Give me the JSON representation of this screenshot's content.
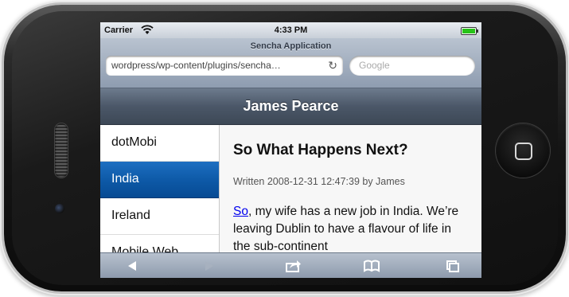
{
  "status_bar": {
    "carrier": "Carrier",
    "time": "4:33 PM",
    "icons": [
      "wifi-icon",
      "battery-icon"
    ]
  },
  "browser": {
    "page_title": "Sencha Application",
    "url": "wordpress/wp-content/plugins/sencha…",
    "search_placeholder": "Google",
    "reload_icon": "reload-icon"
  },
  "app": {
    "title": "James Pearce"
  },
  "sidebar": {
    "items": [
      {
        "label": "dotMobi",
        "selected": false
      },
      {
        "label": "India",
        "selected": true
      },
      {
        "label": "Ireland",
        "selected": false
      },
      {
        "label": "Mobile Web",
        "selected": false
      }
    ]
  },
  "post": {
    "title": "So What Happens Next?",
    "meta": "Written 2008-12-31 12:47:39 by James",
    "body_link": "So",
    "body_text": ", my wife has a new job in India. We’re leaving Dublin to have a flavour of life in the sub-continent"
  },
  "toolbar": {
    "buttons": [
      "back-icon",
      "forward-icon",
      "share-icon",
      "bookmarks-icon",
      "tabs-icon"
    ]
  },
  "colors": {
    "selected_item": "#0e5aa8",
    "titlebar": "#4b5768",
    "link": "#0000ee"
  }
}
